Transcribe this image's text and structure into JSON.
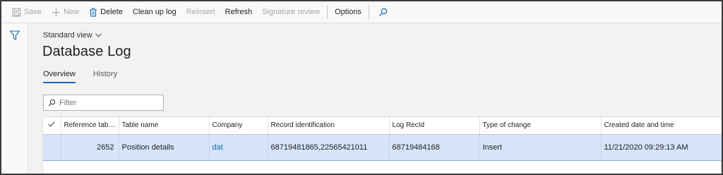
{
  "action_pane": {
    "save": "Save",
    "new": "New",
    "delete": "Delete",
    "clean_up_log": "Clean up log",
    "reinsert": "Reinsert",
    "refresh": "Refresh",
    "signature_review": "Signature review",
    "options": "Options"
  },
  "view": {
    "selector": "Standard view",
    "title": "Database Log"
  },
  "tabs": [
    "Overview",
    "History"
  ],
  "filter": {
    "placeholder": "Filter"
  },
  "grid": {
    "columns": [
      "Reference table...",
      "Table name",
      "Company",
      "Record identification",
      "Log RecId",
      "Type of change",
      "Created date and time"
    ],
    "rows": [
      {
        "reference_table": "2652",
        "table_name": "Position details",
        "company": "dat",
        "record_identification": "68719481865,22565421011",
        "log_recid": "68719484168",
        "type_of_change": "Insert",
        "created": "11/21/2020 09:29:13 AM"
      }
    ]
  },
  "colors": {
    "accent": "#0f6cbd",
    "selected_row": "#d6e4f8",
    "disabled_text": "#a6a6a6"
  }
}
